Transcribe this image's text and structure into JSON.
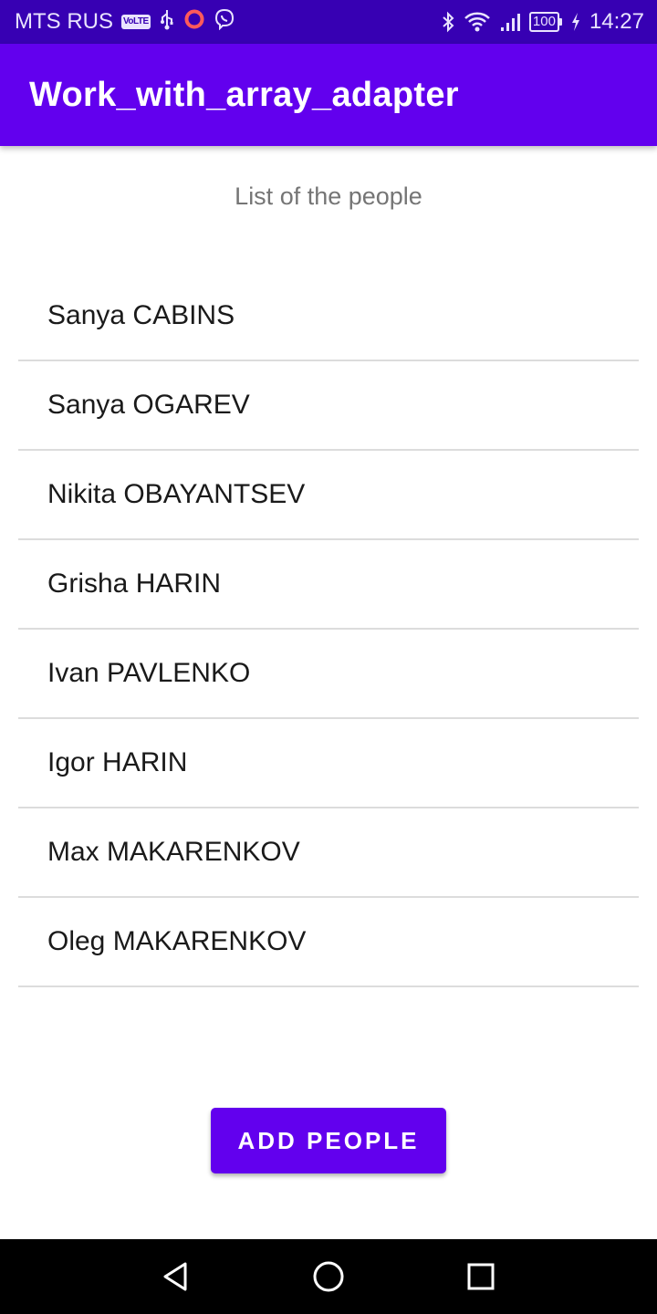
{
  "status_bar": {
    "carrier": "MTS RUS",
    "volte": "VoLTE",
    "battery": "100",
    "time": "14:27"
  },
  "app_bar": {
    "title": "Work_with_array_adapter"
  },
  "list_header": "List of the people",
  "people": [
    "Sanya CABINS",
    "Sanya OGAREV",
    "Nikita OBAYANTSEV",
    "Grisha HARIN",
    "Ivan PAVLENKO",
    "Igor HARIN",
    "Max MAKARENKOV",
    "Oleg MAKARENKOV"
  ],
  "add_button_label": "ADD PEOPLE",
  "colors": {
    "status_bar": "#3700b3",
    "primary": "#6200ee",
    "nav_bar": "#000000"
  },
  "icons": {
    "status_left": [
      "volte-icon",
      "usb-icon",
      "record-icon",
      "viber-icon"
    ],
    "status_right": [
      "bluetooth-icon",
      "wifi-icon",
      "signal-icon",
      "battery-icon",
      "charging-icon"
    ],
    "nav": [
      "back-icon",
      "home-icon",
      "recents-icon"
    ]
  }
}
